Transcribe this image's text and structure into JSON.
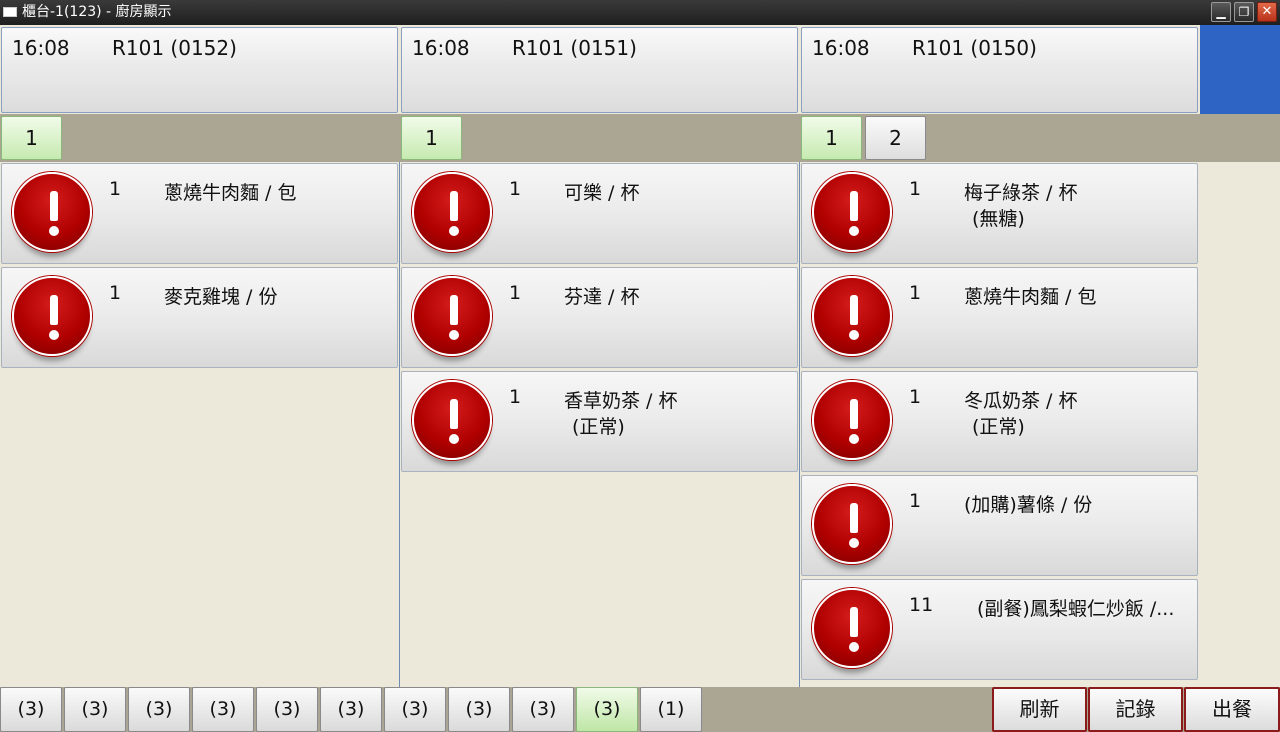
{
  "window": {
    "title": "櫃台-1(123) - 廚房顯示",
    "min_label": "▁",
    "max_label": "❐",
    "close_label": "✕"
  },
  "orders": [
    {
      "time": "16:08",
      "room": "R101 (0152)",
      "pages": [
        "1"
      ],
      "items": [
        {
          "qty": "1",
          "name": "蔥燒牛肉麵 / 包",
          "note": ""
        },
        {
          "qty": "1",
          "name": "麥克雞塊 / 份",
          "note": ""
        }
      ]
    },
    {
      "time": "16:08",
      "room": "R101 (0151)",
      "pages": [
        "1"
      ],
      "items": [
        {
          "qty": "1",
          "name": "可樂 / 杯",
          "note": ""
        },
        {
          "qty": "1",
          "name": "芬達 / 杯",
          "note": ""
        },
        {
          "qty": "1",
          "name": "香草奶茶 / 杯",
          "note": "(正常)"
        }
      ]
    },
    {
      "time": "16:08",
      "room": "R101 (0150)",
      "pages": [
        "1",
        "2"
      ],
      "items": [
        {
          "qty": "1",
          "name": "梅子綠茶 / 杯",
          "note": "(無糖)"
        },
        {
          "qty": "1",
          "name": "蔥燒牛肉麵 / 包",
          "note": ""
        },
        {
          "qty": "1",
          "name": "冬瓜奶茶 / 杯",
          "note": "(正常)"
        },
        {
          "qty": "1",
          "name": "(加購)薯條 / 份",
          "note": ""
        },
        {
          "qty": "11",
          "name": "(副餐)鳳梨蝦仁炒飯 /...",
          "note": ""
        }
      ]
    }
  ],
  "bottom_tabs": [
    "(3)",
    "(3)",
    "(3)",
    "(3)",
    "(3)",
    "(3)",
    "(3)",
    "(3)",
    "(3)",
    "(3)",
    "(1)"
  ],
  "active_bottom_tab_index": 9,
  "actions": {
    "refresh": "刷新",
    "record": "記錄",
    "serve": "出餐"
  },
  "colors": {
    "accent_blue": "#2e64c4",
    "alert_red": "#b00000",
    "active_green": "#c6eab0",
    "background": "#ede9da"
  }
}
